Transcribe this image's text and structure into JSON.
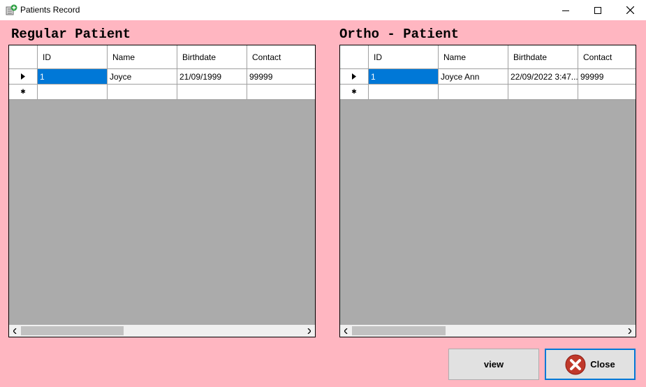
{
  "window": {
    "title": "Patients Record"
  },
  "regular": {
    "title": "Regular Patient",
    "columns": [
      "ID",
      "Name",
      "Birthdate",
      "Contact"
    ],
    "rows": [
      {
        "id": "1",
        "name": "Joyce",
        "birthdate": "21/09/1999",
        "contact": "99999"
      }
    ]
  },
  "ortho": {
    "title": "Ortho - Patient",
    "columns": [
      "ID",
      "Name",
      "Birthdate",
      "Contact"
    ],
    "rows": [
      {
        "id": "1",
        "name": "Joyce Ann",
        "birthdate": "22/09/2022 3:47...",
        "contact": "99999"
      }
    ]
  },
  "buttons": {
    "view": "view",
    "close": "Close"
  },
  "colors": {
    "background": "#ffb6c1",
    "selection": "#0078d7",
    "grid_background": "#ababab"
  },
  "icons": [
    "app-icon",
    "minimize-icon",
    "maximize-icon",
    "close-window-icon",
    "row-pointer-icon",
    "new-row-icon",
    "scroll-left-icon",
    "scroll-right-icon",
    "close-x-icon"
  ]
}
